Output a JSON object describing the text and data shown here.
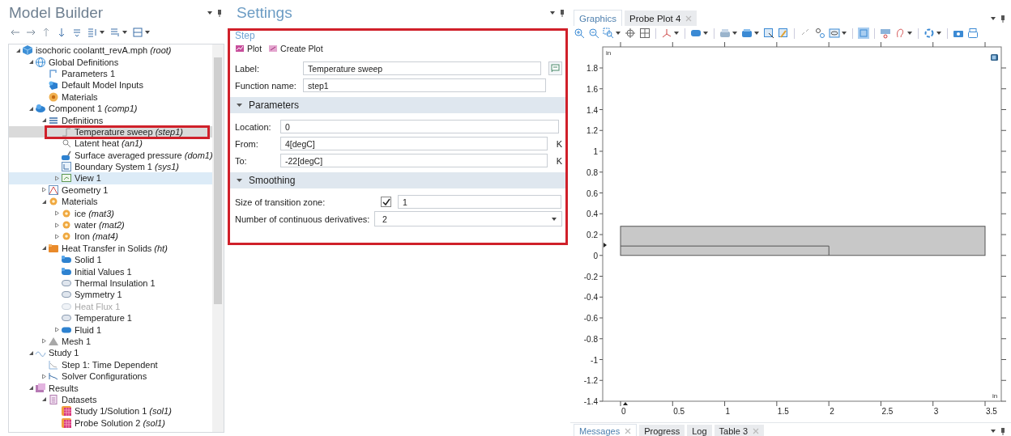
{
  "model_builder": {
    "title": "Model Builder",
    "tree": [
      {
        "label": "isochoric coolantt_revA.mph *(root)*",
        "kind": "model",
        "expanded": true,
        "selected": false,
        "hovered": false,
        "disabled": false,
        "children": [
          {
            "label": "Global Definitions",
            "kind": "globe",
            "expanded": true,
            "selected": false,
            "hovered": false,
            "disabled": false,
            "children": [
              {
                "label": "Parameters 1",
                "kind": "param",
                "selected": false,
                "hovered": false,
                "disabled": false
              },
              {
                "label": "Default Model Inputs",
                "kind": "inputs",
                "selected": false,
                "hovered": false,
                "disabled": false
              },
              {
                "label": "Materials",
                "kind": "materials",
                "selected": false,
                "hovered": false,
                "disabled": false
              }
            ]
          },
          {
            "label": "Component 1 *(comp1)*",
            "kind": "component",
            "expanded": true,
            "selected": false,
            "hovered": false,
            "disabled": false,
            "children": [
              {
                "label": "Definitions",
                "kind": "definitions",
                "expanded": true,
                "selected": false,
                "hovered": false,
                "disabled": false,
                "children": [
                  {
                    "label": "Temperature sweep *(step1)*",
                    "kind": "step",
                    "selected": true,
                    "hovered": false,
                    "disabled": false
                  },
                  {
                    "label": "Latent heat *(an1)*",
                    "kind": "probe",
                    "selected": false,
                    "hovered": false,
                    "disabled": false
                  },
                  {
                    "label": "Surface averaged pressure *(dom1)*",
                    "kind": "coupling",
                    "selected": false,
                    "hovered": false,
                    "disabled": false
                  },
                  {
                    "label": "Boundary System 1 *(sys1)*",
                    "kind": "coordsys",
                    "selected": false,
                    "hovered": false,
                    "disabled": false
                  },
                  {
                    "label": "View 1",
                    "kind": "view",
                    "expanded": false,
                    "selected": false,
                    "hovered": true,
                    "disabled": false
                  }
                ]
              },
              {
                "label": "Geometry 1",
                "kind": "geometry",
                "expanded": false,
                "selected": false,
                "hovered": false,
                "disabled": false
              },
              {
                "label": "Materials",
                "kind": "material",
                "expanded": true,
                "selected": false,
                "hovered": false,
                "disabled": false,
                "children": [
                  {
                    "label": "ice *(mat3)*",
                    "kind": "material",
                    "expanded": false,
                    "selected": false,
                    "hovered": false,
                    "disabled": false
                  },
                  {
                    "label": "water *(mat2)*",
                    "kind": "material",
                    "expanded": false,
                    "selected": false,
                    "hovered": false,
                    "disabled": false
                  },
                  {
                    "label": "Iron *(mat4)*",
                    "kind": "material",
                    "expanded": false,
                    "selected": false,
                    "hovered": false,
                    "disabled": false
                  }
                ]
              },
              {
                "label": "Heat Transfer in Solids *(ht)*",
                "kind": "physics",
                "expanded": true,
                "selected": false,
                "hovered": false,
                "disabled": false,
                "children": [
                  {
                    "label": "Solid 1",
                    "kind": "domain",
                    "selected": false,
                    "hovered": false,
                    "disabled": false
                  },
                  {
                    "label": "Initial Values 1",
                    "kind": "domain",
                    "selected": false,
                    "hovered": false,
                    "disabled": false
                  },
                  {
                    "label": "Thermal Insulation 1",
                    "kind": "boundary",
                    "selected": false,
                    "hovered": false,
                    "disabled": false
                  },
                  {
                    "label": "Symmetry 1",
                    "kind": "boundary",
                    "selected": false,
                    "hovered": false,
                    "disabled": false
                  },
                  {
                    "label": "Heat Flux 1",
                    "kind": "boundary",
                    "selected": false,
                    "hovered": false,
                    "disabled": true
                  },
                  {
                    "label": "Temperature 1",
                    "kind": "boundary",
                    "selected": false,
                    "hovered": false,
                    "disabled": false
                  },
                  {
                    "label": "Fluid 1",
                    "kind": "fluid",
                    "expanded": false,
                    "selected": false,
                    "hovered": false,
                    "disabled": false
                  }
                ]
              },
              {
                "label": "Mesh 1",
                "kind": "mesh",
                "expanded": false,
                "selected": false,
                "hovered": false,
                "disabled": false
              }
            ]
          },
          {
            "label": "Study 1",
            "kind": "study",
            "expanded": true,
            "selected": false,
            "hovered": false,
            "disabled": false,
            "children": [
              {
                "label": "Step 1: Time Dependent",
                "kind": "study-step",
                "selected": false,
                "hovered": false,
                "disabled": false
              },
              {
                "label": "Solver Configurations",
                "kind": "solver",
                "expanded": false,
                "selected": false,
                "hovered": false,
                "disabled": false
              }
            ]
          },
          {
            "label": "Results",
            "kind": "results",
            "expanded": true,
            "selected": false,
            "hovered": false,
            "disabled": false,
            "children": [
              {
                "label": "Datasets",
                "kind": "datasets",
                "expanded": true,
                "selected": false,
                "hovered": false,
                "disabled": false,
                "children": [
                  {
                    "label": "Study 1/Solution 1 *(sol1)*",
                    "kind": "solution",
                    "selected": false,
                    "hovered": false,
                    "disabled": false
                  },
                  {
                    "label": "Probe Solution 2 *(sol1)*",
                    "kind": "solution",
                    "selected": false,
                    "hovered": false,
                    "disabled": false
                  }
                ]
              }
            ]
          }
        ]
      }
    ]
  },
  "settings": {
    "title": "Settings",
    "framed": true,
    "node_type": "Step",
    "actions": [
      {
        "label": "Plot"
      },
      {
        "label": "Create Plot"
      }
    ],
    "fields": [
      {
        "label": "Label:",
        "value": "Temperature sweep"
      },
      {
        "label": "Function name:",
        "value": "step1"
      }
    ],
    "sections": [
      {
        "title": "Parameters",
        "expanded": true,
        "rows": [
          {
            "kind": "text",
            "label": "Location:",
            "value": "0"
          },
          {
            "kind": "text",
            "label": "From:",
            "value": "4[degC]",
            "unit": "K"
          },
          {
            "kind": "text",
            "label": "To:",
            "value": "-22[degC]",
            "unit": "K"
          }
        ]
      },
      {
        "title": "Smoothing",
        "expanded": true,
        "rows": [
          {
            "kind": "check-text",
            "label": "Size of transition zone:",
            "checked": true,
            "value": "1"
          },
          {
            "kind": "select",
            "label": "Number of continuous derivatives:",
            "value": "2"
          }
        ]
      }
    ]
  },
  "graphics": {
    "tabs": [
      {
        "label": "Graphics",
        "selected": true,
        "closable": false
      },
      {
        "label": "Probe Plot 4",
        "selected": false,
        "closable": true
      }
    ],
    "plot": {
      "x_unit": "in",
      "y_unit": "in",
      "yticks": [
        "1.8",
        "1.6",
        "1.4",
        "1.2",
        "1",
        "0.8",
        "0.6",
        "0.4",
        "0.2",
        "0",
        "-0.2",
        "-0.4",
        "-0.6",
        "-0.8",
        "-1",
        "-1.2",
        "-1.4"
      ],
      "xticks": [
        "0",
        "0.5",
        "1",
        "1.5",
        "2",
        "2.5",
        "3",
        "3.5"
      ]
    }
  },
  "bottom_tabs": [
    {
      "label": "Messages",
      "selected": true,
      "closable": true
    },
    {
      "label": "Progress",
      "selected": false,
      "closable": false
    },
    {
      "label": "Log",
      "selected": false,
      "closable": false
    },
    {
      "label": "Table 3",
      "selected": false,
      "closable": true
    }
  ]
}
